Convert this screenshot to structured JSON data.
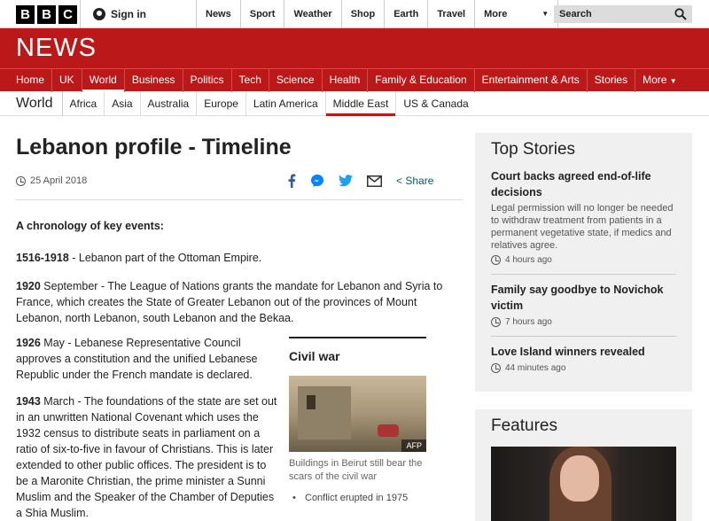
{
  "header": {
    "logo_letters": [
      "B",
      "B",
      "C"
    ],
    "signin_label": "Sign in",
    "links": [
      "News",
      "Sport",
      "Weather",
      "Shop",
      "Earth",
      "Travel"
    ],
    "more_label": "More",
    "search_placeholder": "Search"
  },
  "banner": {
    "title": "NEWS"
  },
  "nav": {
    "items": [
      "Home",
      "UK",
      "World",
      "Business",
      "Politics",
      "Tech",
      "Science",
      "Health",
      "Family & Education",
      "Entertainment & Arts",
      "Stories",
      "More"
    ],
    "active": "World"
  },
  "subnav": {
    "section": "World",
    "items": [
      "Africa",
      "Asia",
      "Australia",
      "Europe",
      "Latin America",
      "Middle East",
      "US & Canada"
    ],
    "active": "Middle East"
  },
  "article": {
    "headline": "Lebanon profile - Timeline",
    "date": "25 April 2018",
    "share_label": "Share",
    "intro": "A chronology of key events:",
    "entries": [
      {
        "year": "1516-1918",
        "text": " - Lebanon part of the Ottoman Empire."
      },
      {
        "year": "1920",
        "text": " September - The League of Nations grants the mandate for Lebanon and Syria to France, which creates the State of Greater Lebanon out of the provinces of Mount Lebanon, north Lebanon, south Lebanon and the Bekaa."
      },
      {
        "year": "1926",
        "text": " May - Lebanese Representative Council approves a constitution and the unified Lebanese Republic under the French mandate is declared."
      },
      {
        "year": "1943",
        "text": " March - The foundations of the state are set out in an unwritten National Covenant which uses the 1932 census to distribute seats in parliament on a ratio of six-to-five in favour of Christians. This is later extended to other public offices. The president is to be a Maronite Christian, the prime minister a Sunni Muslim and the Speaker of the Chamber of Deputies a Shia Muslim."
      }
    ],
    "civil_war": {
      "title": "Civil war",
      "image_agency": "AFP",
      "caption": "Buildings in Beirut still bear the scars of the civil war",
      "bullet": "Conflict erupted in 1975"
    }
  },
  "sidebar": {
    "top_stories_title": "Top Stories",
    "stories": [
      {
        "title": "Court backs agreed end-of-life decisions",
        "summary": "Legal permission will no longer be needed to withdraw treatment from patients in a permanent vegetative state, if medics and relatives agree.",
        "time": "4 hours ago"
      },
      {
        "title": "Family say goodbye to Novichok victim",
        "time": "7 hours ago"
      },
      {
        "title": "Love Island winners revealed",
        "time": "44 minutes ago"
      }
    ],
    "features_title": "Features"
  }
}
